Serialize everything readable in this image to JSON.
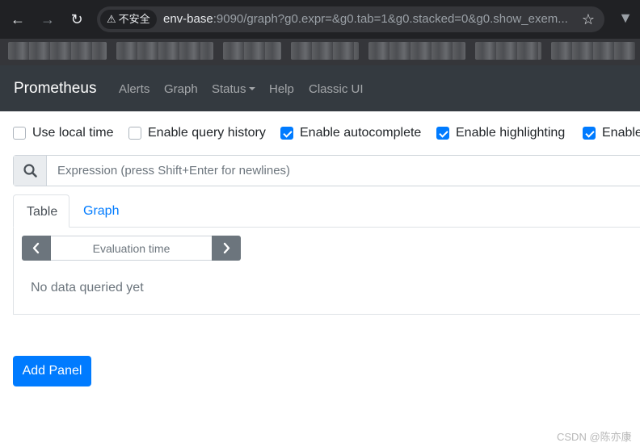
{
  "browser": {
    "security_label": "不安全",
    "url_host": "env-base",
    "url_rest": ":9090/graph?g0.expr=&g0.tab=1&g0.stacked=0&g0.show_exem..."
  },
  "navbar": {
    "brand": "Prometheus",
    "links": [
      "Alerts",
      "Graph",
      "Status",
      "Help",
      "Classic UI"
    ]
  },
  "options": [
    {
      "label": "Use local time",
      "checked": false
    },
    {
      "label": "Enable query history",
      "checked": false
    },
    {
      "label": "Enable autocomplete",
      "checked": true
    },
    {
      "label": "Enable highlighting",
      "checked": true
    },
    {
      "label": "Enable",
      "checked": true
    }
  ],
  "expression": {
    "placeholder": "Expression (press Shift+Enter for newlines)",
    "value": ""
  },
  "panel": {
    "tabs": [
      "Table",
      "Graph"
    ],
    "active_tab": "Table",
    "evaluation_time_placeholder": "Evaluation time",
    "empty_message": "No data queried yet"
  },
  "add_panel_label": "Add Panel",
  "watermark": "CSDN @陈亦康",
  "colors": {
    "navbar_bg": "#343a40",
    "primary": "#007bff",
    "secondary": "#6c757d"
  }
}
